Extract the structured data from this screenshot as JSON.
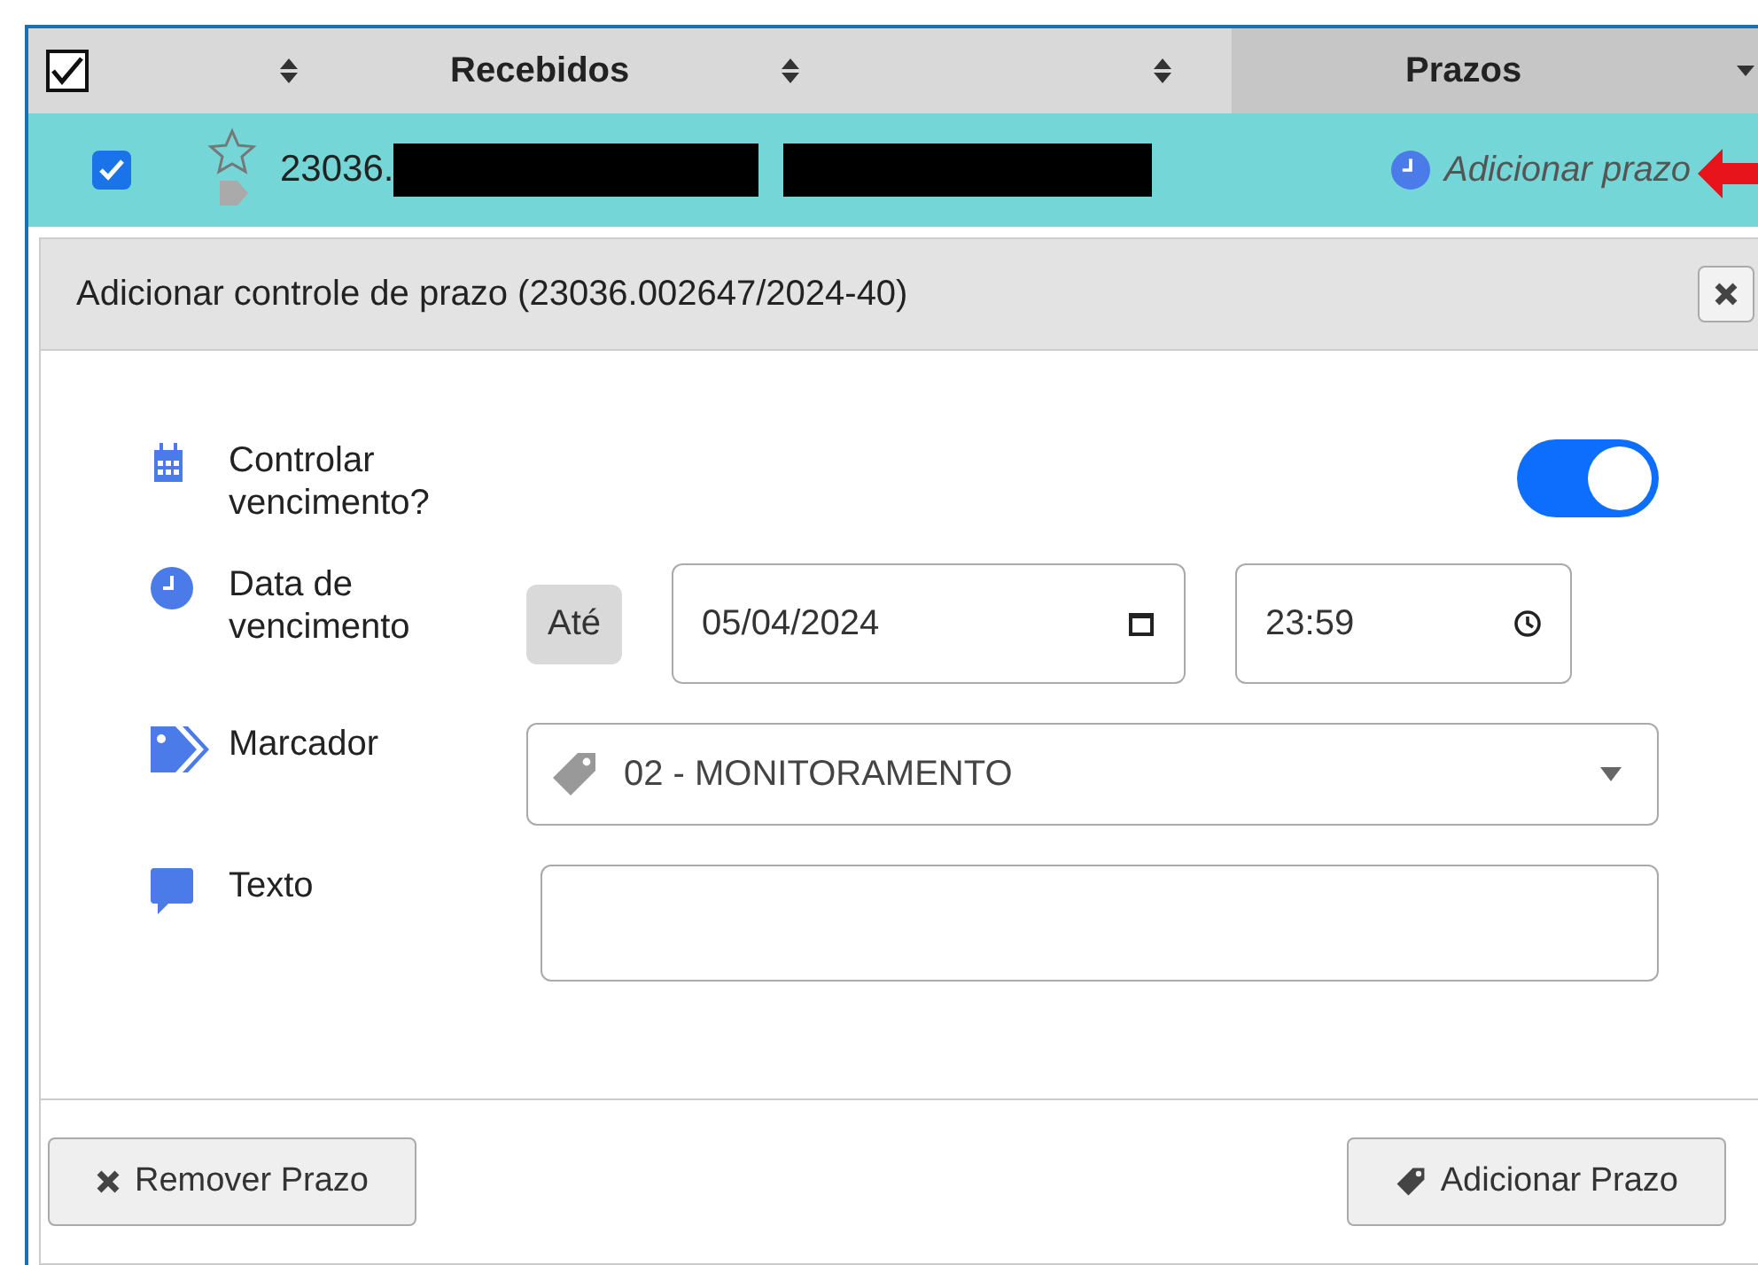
{
  "table": {
    "header_checkbox": {
      "checked": true
    },
    "columns": [
      {
        "label": "Recebidos",
        "selected": false
      },
      {
        "label": "Prazos",
        "selected": true
      }
    ],
    "row": {
      "checked": true,
      "starred": false,
      "number": "23036.",
      "action": "Adicionar prazo"
    }
  },
  "dialog": {
    "title": "Adicionar controle de prazo (23036.002647/2024-40)",
    "fields": [
      {
        "kind": "toggle",
        "label": "Controlar vencimento?",
        "on": true
      },
      {
        "kind": "datetime",
        "label": "Data de vencimento",
        "prefix": "Até",
        "date": "05/04/2024",
        "time": "23:59"
      },
      {
        "kind": "select",
        "label": "Marcador",
        "value": "02 - MONITORAMENTO"
      },
      {
        "kind": "text",
        "label": "Texto"
      }
    ],
    "buttons": [
      {
        "label": "Remover Prazo",
        "kind": "remove"
      },
      {
        "label": "Adicionar Prazo",
        "kind": "add"
      }
    ]
  }
}
